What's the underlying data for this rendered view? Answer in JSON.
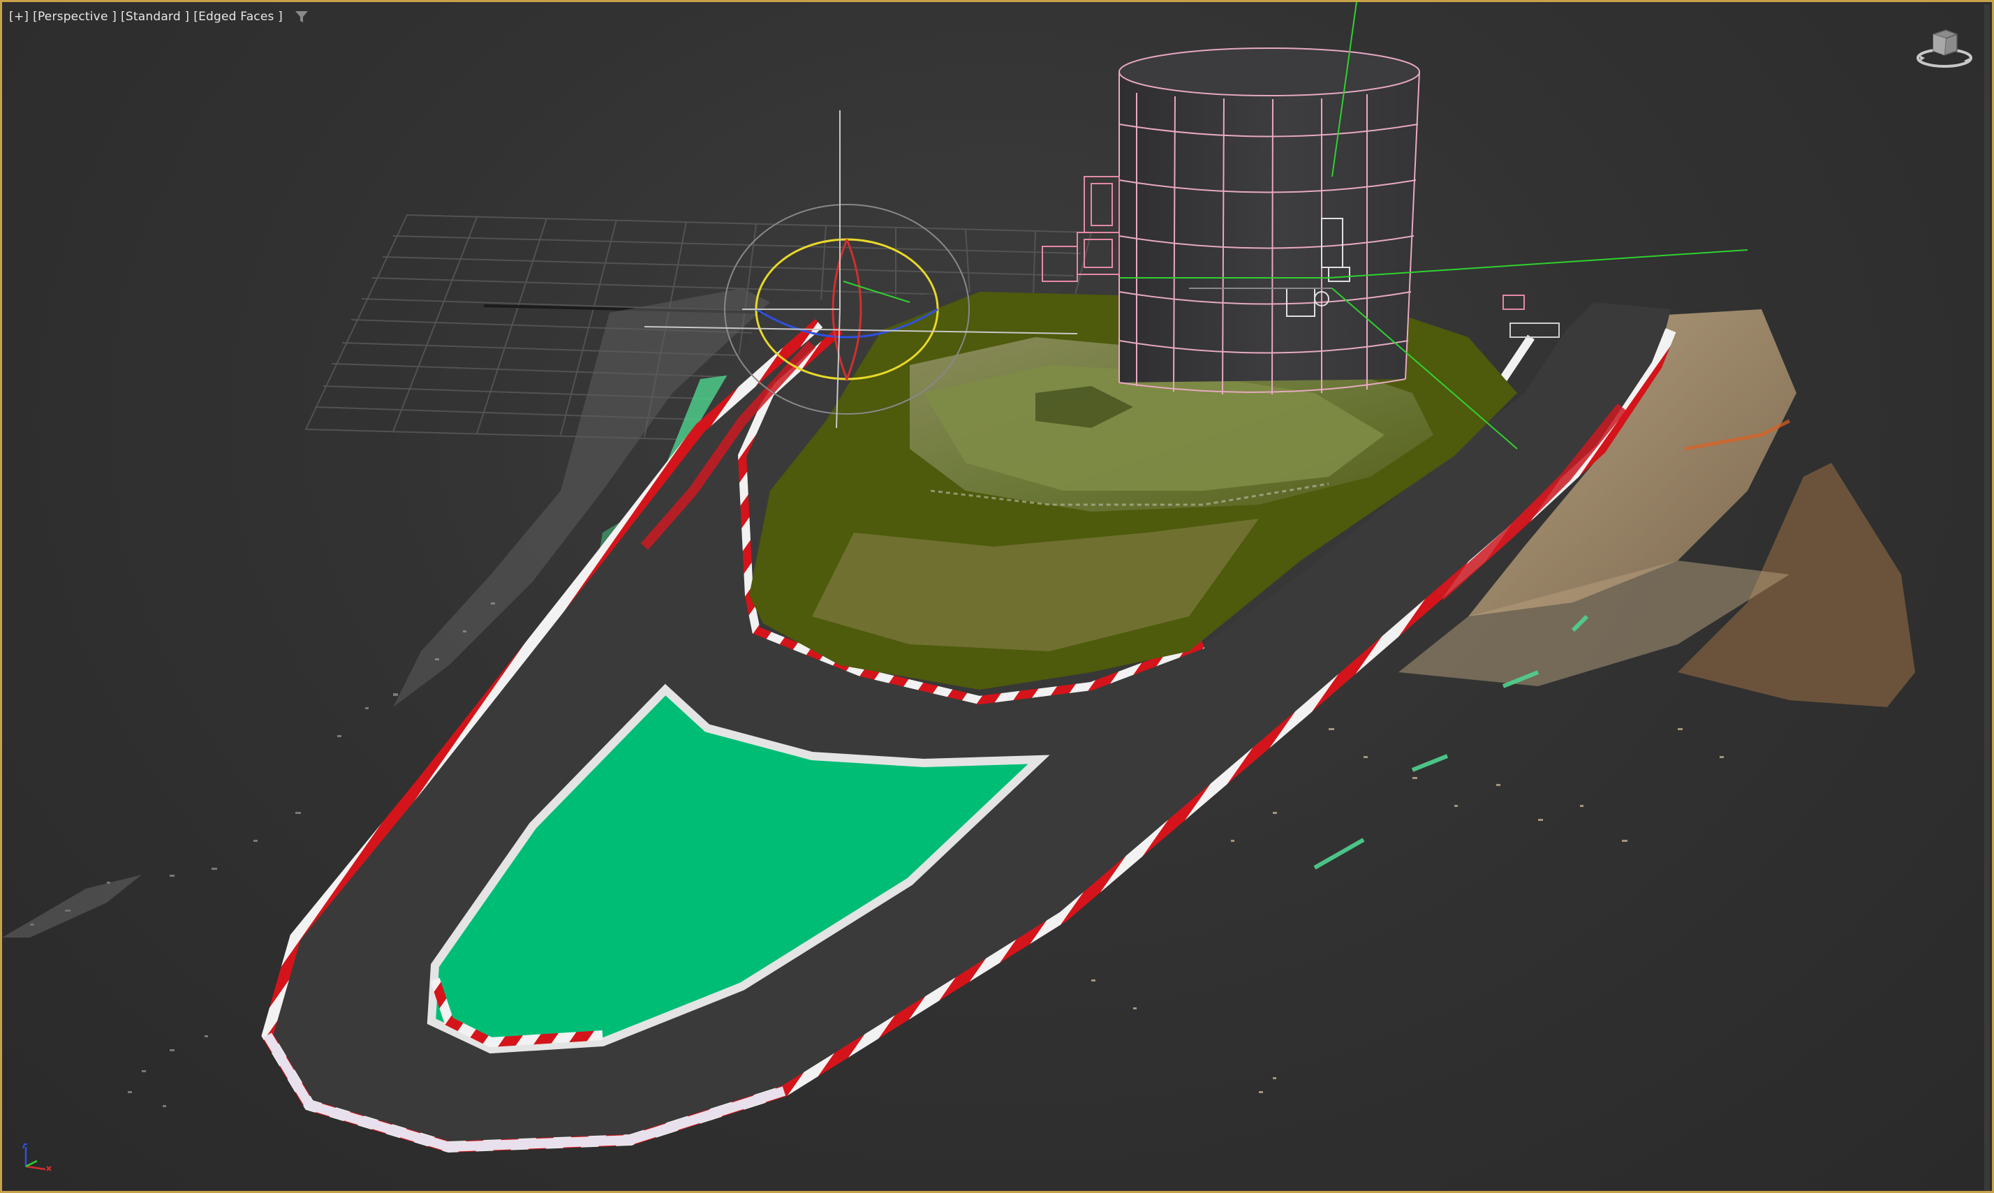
{
  "viewport": {
    "labels": [
      "[+]",
      "[Perspective ]",
      "[Standard ]",
      "[Edged Faces ]"
    ],
    "filter_icon": "funnel-icon",
    "viewcube_icon": "viewcube-icon",
    "axis_icon": "xyz-axis-tripod-icon"
  },
  "colors": {
    "border_active": "#c8a24a",
    "background": "#333333",
    "asphalt": "#3c3c3c",
    "curb_red": "#d4141a",
    "curb_white": "#f2f2f2",
    "grass_flat": "#00bd76",
    "grass_moss": "#4e5a0c",
    "grass_natural": "#7c8442",
    "tower": "#3c3b3e",
    "tower_edges": "#e8a9c2",
    "gizmo_green": "#2fd22f",
    "gizmo_red": "#d22f2f",
    "gizmo_blue": "#3050e0",
    "gizmo_yellow": "#e8d82a"
  }
}
